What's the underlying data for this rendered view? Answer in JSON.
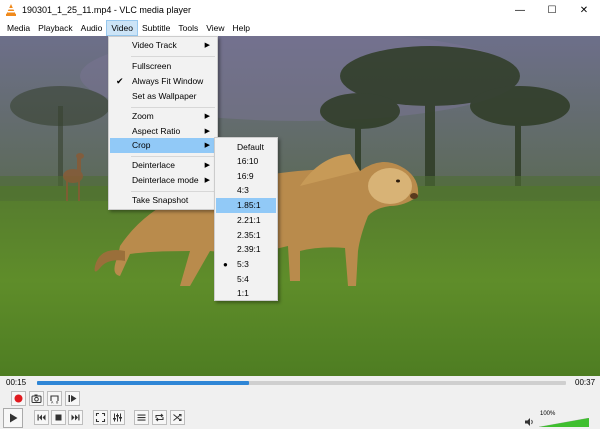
{
  "window": {
    "title": "190301_1_25_11.mp4 - VLC media player",
    "minimize": "—",
    "maximize": "☐",
    "close": "✕"
  },
  "menubar": [
    "Media",
    "Playback",
    "Audio",
    "Video",
    "Subtitle",
    "Tools",
    "View",
    "Help"
  ],
  "video_menu": {
    "items": [
      {
        "label": "Video Track",
        "submenu": true
      },
      {
        "label": "Fullscreen"
      },
      {
        "label": "Always Fit Window",
        "checked": true
      },
      {
        "label": "Set as Wallpaper"
      },
      {
        "label": "Zoom",
        "submenu": true
      },
      {
        "label": "Aspect Ratio",
        "submenu": true
      },
      {
        "label": "Crop",
        "submenu": true,
        "highlighted": true
      },
      {
        "label": "Deinterlace",
        "submenu": true
      },
      {
        "label": "Deinterlace mode",
        "submenu": true
      },
      {
        "label": "Take Snapshot"
      }
    ],
    "arrow": "▶",
    "check": "✔"
  },
  "crop_menu": {
    "items": [
      "Default",
      "16:10",
      "16:9",
      "4:3",
      "1.85:1",
      "2.21:1",
      "2.35:1",
      "2.39:1",
      "5:3",
      "5:4",
      "1:1"
    ],
    "highlighted": "1.85:1",
    "selected": "5:3",
    "dot": "●"
  },
  "playback": {
    "elapsed": "00:15",
    "total": "00:37",
    "progress_fraction": 0.4
  },
  "volume": {
    "label": "100%",
    "level_fraction": 1.0
  },
  "colors": {
    "accent": "#2f86d6",
    "record": "#e0191e",
    "menu_highlight": "#91c9f7",
    "volume_green": "#3fbf2f"
  }
}
